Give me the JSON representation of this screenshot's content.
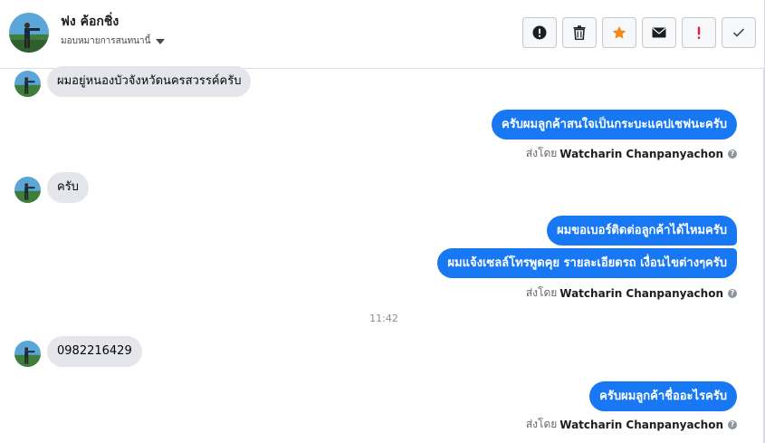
{
  "header": {
    "contact_name": "ฟง ค้อกชิ่ง",
    "assign_label": "มอบหมายการสนทนานี้",
    "actions": [
      {
        "name": "alert-circle-icon",
        "color": "#1c1e21"
      },
      {
        "name": "trash-icon",
        "color": "#1c1e21"
      },
      {
        "name": "star-icon",
        "color": "#f28a19"
      },
      {
        "name": "envelope-icon",
        "color": "#1c1e21"
      },
      {
        "name": "exclamation-icon",
        "color": "#e41e3f"
      },
      {
        "name": "check-icon",
        "color": "#444950"
      }
    ]
  },
  "messages": {
    "in_1": "ผมอยู่หนองบัวจังหวัดนครสวรรค์ครับ",
    "out_1": "ครับผมลูกค้าสนใจเป็นกระบะแคปเชฟนะครับ",
    "in_2": "ครับ",
    "out_2a": "ผมขอเบอร์ติดต่อลูกค้าได้ไหมครับ",
    "out_2b": "ผมแจ้งเซลล์โทรพูดคุย รายละเอียดรถ เงื่อนไขต่างๆครับ",
    "time_1": "11:42",
    "in_3": "0982216429",
    "out_3": "ครับผมลูกค้าชื่ออะไรครับ"
  },
  "sent_by": {
    "prefix": "ส่งโดย",
    "agent": "Watcharin Chanpanyachon",
    "help": "?"
  },
  "colors": {
    "outgoing_bubble": "#1877f2",
    "incoming_bubble": "#e4e6eb"
  }
}
